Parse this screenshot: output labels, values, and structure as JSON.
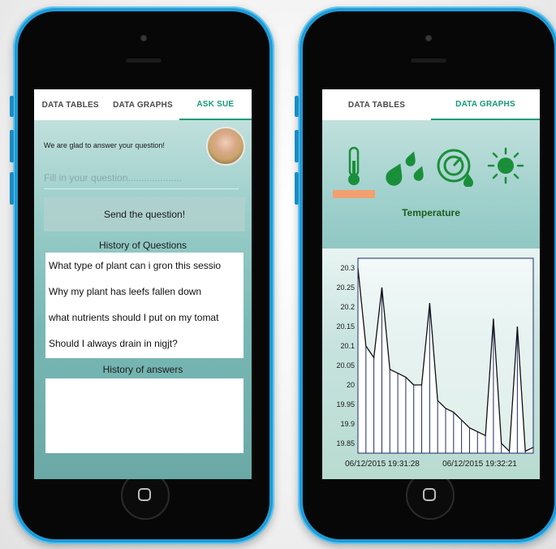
{
  "left": {
    "tabs": [
      "DATA TABLES",
      "DATA GRAPHS",
      "ASK SUE"
    ],
    "greeting": "We are glad to answer your question!",
    "question_placeholder": "Fill in your question....................",
    "send_button": "Send the question!",
    "history_questions_title": "History of Questions",
    "questions": [
      "What type of plant can i gron this sessio",
      "Why my plant has leefs fallen down",
      "what nutrients should I put on my tomat",
      "Should I always drain in nigjt?"
    ],
    "history_answers_title": "History of answers",
    "answers": []
  },
  "right": {
    "tabs": [
      "DATA TABLES",
      "DATA GRAPHS"
    ],
    "sensors": [
      "thermometer-icon",
      "water-drops-icon",
      "gauge-icon",
      "sun-icon"
    ],
    "selected_sensor_label": "Temperature",
    "colors": {
      "accent": "#169b77",
      "selected": "#f2a070",
      "icon": "#1a8f3a"
    }
  },
  "chart_data": {
    "type": "area",
    "title": "",
    "xlabel": "",
    "ylabel": "",
    "ylim": [
      19.825,
      20.325
    ],
    "yticks": [
      "20.3",
      "20.25",
      "20.2",
      "20.15",
      "20.1",
      "20.05",
      "20",
      "19.95",
      "19.9",
      "19.85"
    ],
    "x_tick_labels": [
      "06/12/2015 19:31:28",
      "06/12/2015 19:32:21"
    ],
    "series": [
      {
        "values": [
          20.3,
          20.1,
          20.07,
          20.25,
          20.04,
          20.03,
          20.02,
          20.0,
          20.0,
          20.21,
          19.96,
          19.94,
          19.93,
          19.91,
          19.89,
          19.88,
          19.87,
          20.17,
          19.85,
          19.83,
          20.15,
          19.83,
          19.84
        ]
      }
    ]
  }
}
